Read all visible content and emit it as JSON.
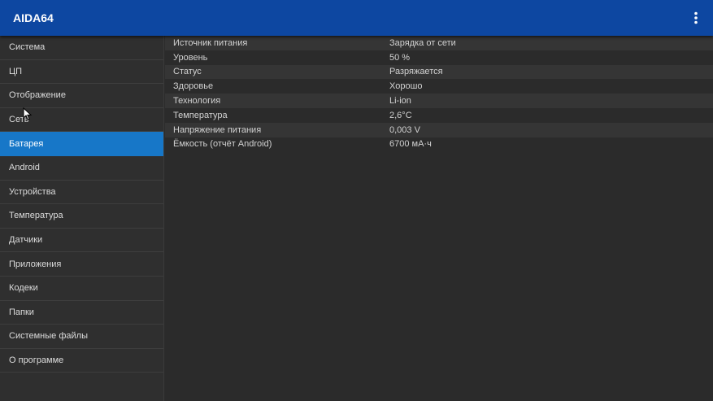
{
  "app": {
    "title": "AIDA64"
  },
  "toolbar": {
    "menu_icon": "more-vert-icon"
  },
  "sidebar": {
    "items": [
      {
        "label": "Система",
        "active": false
      },
      {
        "label": "ЦП",
        "active": false
      },
      {
        "label": "Отображение",
        "active": false
      },
      {
        "label": "Сеть",
        "active": false
      },
      {
        "label": "Батарея",
        "active": true
      },
      {
        "label": "Android",
        "active": false
      },
      {
        "label": "Устройства",
        "active": false
      },
      {
        "label": "Температура",
        "active": false
      },
      {
        "label": "Датчики",
        "active": false
      },
      {
        "label": "Приложения",
        "active": false
      },
      {
        "label": "Кодеки",
        "active": false
      },
      {
        "label": "Папки",
        "active": false
      },
      {
        "label": "Системные файлы",
        "active": false
      },
      {
        "label": "О программе",
        "active": false
      }
    ]
  },
  "battery": {
    "rows": [
      {
        "key": "Источник питания",
        "value": "Зарядка от сети"
      },
      {
        "key": "Уровень",
        "value": "50 %"
      },
      {
        "key": "Статус",
        "value": "Разряжается"
      },
      {
        "key": "Здоровье",
        "value": "Хорошо"
      },
      {
        "key": "Технология",
        "value": "Li-ion"
      },
      {
        "key": "Температура",
        "value": "2,6°C"
      },
      {
        "key": "Напряжение питания",
        "value": "0,003 V"
      },
      {
        "key": "Ёмкость (отчёт Android)",
        "value": "6700 мА·ч"
      }
    ]
  },
  "colors": {
    "appbar": "#0d47a1",
    "active_item": "#1777c8",
    "background": "#2b2b2b"
  }
}
